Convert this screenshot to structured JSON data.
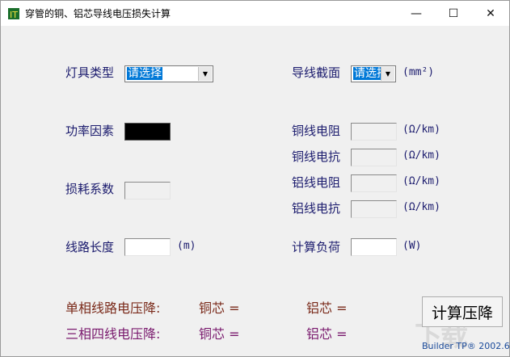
{
  "window": {
    "title": "穿管的铜、铝芯导线电压损失计算",
    "controls": {
      "minimize": "—",
      "maximize": "☐",
      "close": "✕"
    }
  },
  "left": {
    "lamp_type_label": "灯具类型",
    "lamp_type_value": "请选择",
    "power_factor_label": "功率因素",
    "loss_coef_label": "损耗系数",
    "loss_coef_value": "",
    "line_length_label": "线路长度",
    "line_length_value": "",
    "line_length_unit": "(m)"
  },
  "right": {
    "wire_section_label": "导线截面",
    "wire_section_value": "请选择",
    "wire_section_unit": "(mm²)",
    "cu_resistance_label": "铜线电阻",
    "cu_reactance_label": "铜线电抗",
    "al_resistance_label": "铝线电阻",
    "al_reactance_label": "铝线电抗",
    "ohm_unit": "(Ω/km)",
    "calc_load_label": "计算负荷",
    "calc_load_unit": "(W)"
  },
  "results": {
    "single_phase_label": "单相线路电压降:",
    "three_phase_label": "三相四线电压降:",
    "copper": "铜芯 =",
    "aluminum": "铝芯 ="
  },
  "calc_button": "计算压降",
  "footer": "Builder TP® 2002.6",
  "watermark": "下载",
  "colors": {
    "selection": "#0078d7",
    "label": "#1c1c6e",
    "single": "#7a2a1a",
    "three": "#7a1a6e"
  }
}
